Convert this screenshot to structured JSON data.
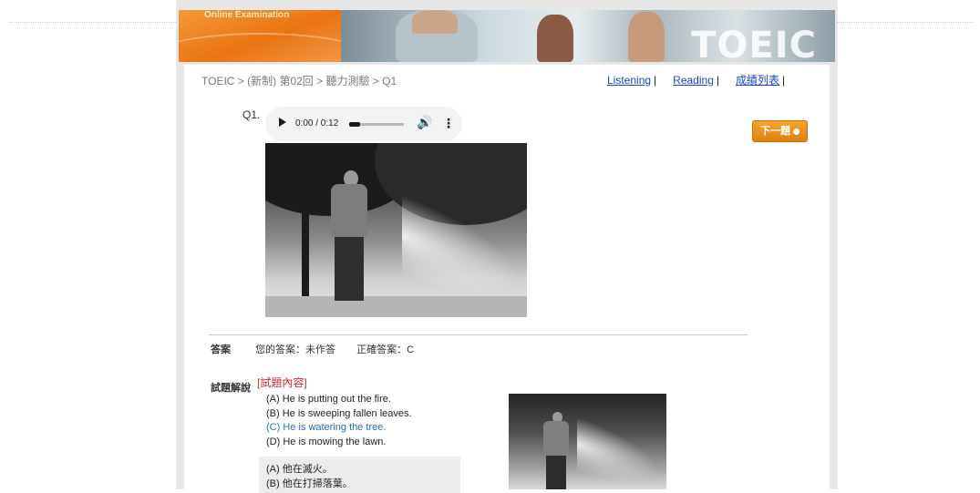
{
  "banner": {
    "title": "Online Examination",
    "logo": "TOEIC"
  },
  "breadcrumb": "TOEIC > (新制) 第02回 > 聽力測驗 > Q1",
  "nav": {
    "listening": "Listening",
    "reading": "Reading",
    "scores": "成績列表",
    "separator": "|"
  },
  "question": {
    "label": "Q1."
  },
  "audio": {
    "time": "0:00 / 0:12",
    "progress": 0.0
  },
  "next_button": "下一題",
  "answer": {
    "label": "答案",
    "yours": "您的答案：未作答",
    "correct": "正確答案：C"
  },
  "explanation": {
    "label": "試題解說",
    "link": "[試題內容]",
    "options": [
      {
        "text": "(A) He is putting out the fire."
      },
      {
        "text": "(B) He is sweeping fallen leaves."
      },
      {
        "text": "(C) He is watering the tree.",
        "correct": true
      },
      {
        "text": "(D) He is mowing the lawn."
      }
    ],
    "translations": [
      "(A) 他在滅火。",
      "(B) 他在打掃落葉。"
    ]
  },
  "colors": {
    "accent_orange": "#e9830f",
    "link_blue": "#1f46c9",
    "correct_blue": "#2c6fb6",
    "link_red": "#cc2b2b"
  }
}
